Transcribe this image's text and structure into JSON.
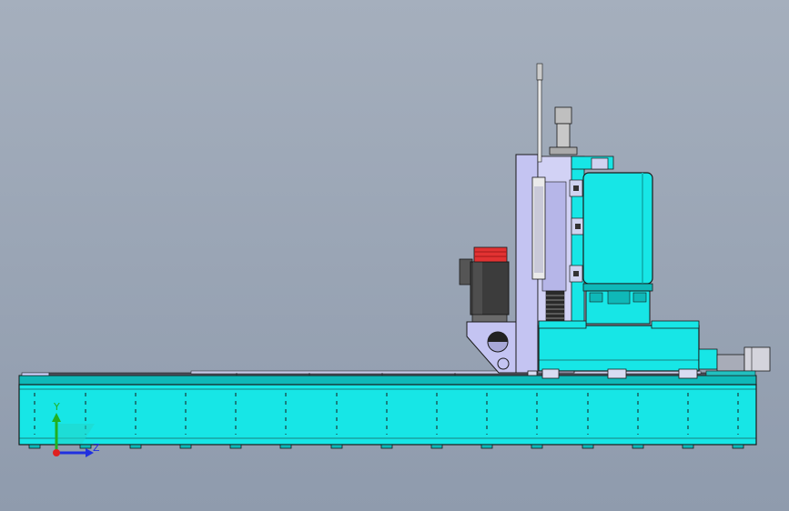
{
  "view": {
    "background_top": "#a5afbd",
    "background_bottom": "#8f9bad"
  },
  "triad": {
    "y_label": "Y",
    "z_label": "Z",
    "y_color": "#20b020",
    "z_color": "#2030e0",
    "origin_color": "#e02020"
  },
  "colors": {
    "body_cyan": "#17e6e6",
    "cyan_dark": "#0fb8b8",
    "column_lavender": "#c4c4f2",
    "motor_dark": "#3c3c3c",
    "motor_red": "#e23232",
    "outline": "#1a1a1a"
  }
}
